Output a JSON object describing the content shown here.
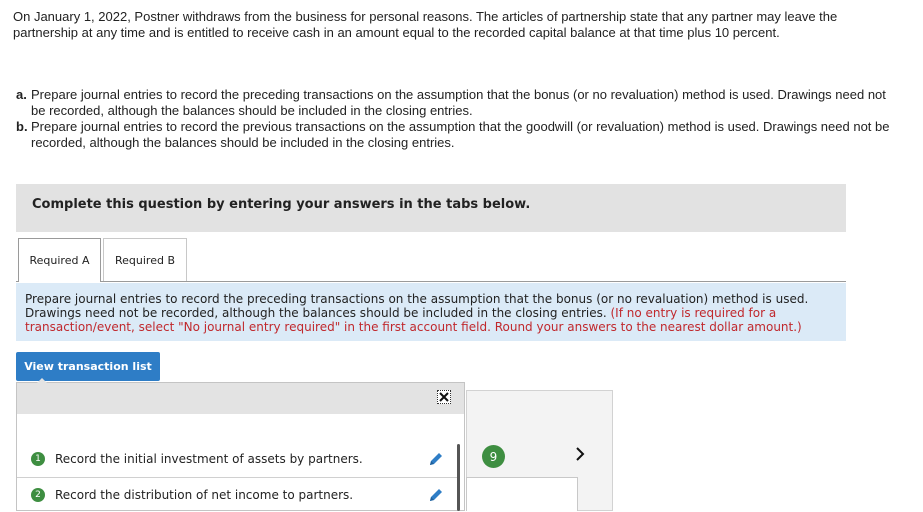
{
  "intro_text": "On January 1, 2022, Postner withdraws from the business for personal reasons. The articles of partnership state that any partner may leave the partnership at any time and is entitled to receive cash in an amount equal to the recorded capital balance at that time plus 10 percent.",
  "parts": [
    {
      "label": "a.",
      "text": "Prepare journal entries to record the preceding transactions on the assumption that the bonus (or no revaluation) method is used. Drawings need not be recorded, although the balances should be included in the closing entries."
    },
    {
      "label": "b.",
      "text": "Prepare journal entries to record the previous transactions on the assumption that the goodwill (or revaluation) method is used. Drawings need not be recorded, although the balances should be included in the closing entries."
    }
  ],
  "banner_text": "Complete this question by entering your answers in the tabs below.",
  "tabs": [
    {
      "label": "Required A",
      "active": true
    },
    {
      "label": "Required B",
      "active": false
    }
  ],
  "instructions": {
    "main": "Prepare journal entries to record the preceding transactions on the assumption that the bonus (or no revaluation) method is used. Drawings need not be recorded, although the balances should be included in the closing entries.",
    "note": "(If no entry is required for a transaction/event, select \"No journal entry required\" in the first account field. Round your answers to the nearest dollar amount.)"
  },
  "view_transaction_button": "View transaction list",
  "transactions": [
    {
      "number": "1",
      "text": "Record the initial investment of assets by partners."
    },
    {
      "number": "2",
      "text": "Record the distribution of net income to partners."
    }
  ],
  "entry_badge": "9",
  "colors": {
    "accent_blue": "#2e7dc6",
    "instruction_bg": "#dbeaf7",
    "note_red": "#c0282d",
    "number_green": "#3e8e41",
    "banner_bg": "#e2e2e2"
  },
  "icons": {
    "close": "close-icon",
    "edit": "pencil-icon",
    "next": "chevron-right-icon"
  }
}
